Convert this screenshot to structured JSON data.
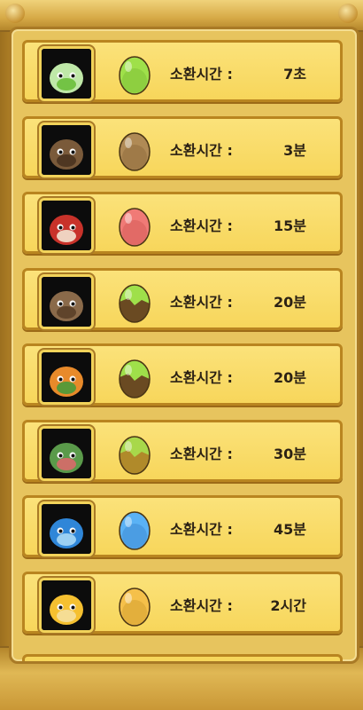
{
  "colors": {
    "row_bg": "#f7d65b",
    "row_border": "#b98520",
    "frame": "#c9982f"
  },
  "rows": [
    {
      "label": "소환시간 :",
      "time": "7초",
      "egg_icon": "green-egg-icon",
      "egg_color": "#7cc23a",
      "monster_icon": "green-sprout-blob-icon"
    },
    {
      "label": "소환시간 :",
      "time": "3분",
      "egg_icon": "brown-egg-icon",
      "egg_color": "#8a6a3a",
      "monster_icon": "brown-rabbit-monster-icon"
    },
    {
      "label": "소환시간 :",
      "time": "15분",
      "egg_icon": "red-egg-icon",
      "egg_color": "#e05a56",
      "monster_icon": "red-panda-monster-icon"
    },
    {
      "label": "소환시간 :",
      "time": "20분",
      "egg_icon": "green-brown-egg-icon",
      "egg_color": "#7cc23a",
      "monster_icon": "brown-mole-monster-icon"
    },
    {
      "label": "소환시간 :",
      "time": "20분",
      "egg_icon": "green-brown-egg-icon",
      "egg_color": "#7cc23a",
      "monster_icon": "orange-bird-monster-icon"
    },
    {
      "label": "소환시간 :",
      "time": "30분",
      "egg_icon": "green-yellow-egg-icon",
      "egg_color": "#9acb3a",
      "monster_icon": "green-turtle-monster-icon"
    },
    {
      "label": "소환시간 :",
      "time": "45분",
      "egg_icon": "blue-egg-icon",
      "egg_color": "#3a8fe0",
      "monster_icon": "blue-seal-monster-icon"
    },
    {
      "label": "소환시간 :",
      "time": "2시간",
      "egg_icon": "gold-egg-icon",
      "egg_color": "#e0a52a",
      "monster_icon": "yellow-chick-monster-icon"
    }
  ]
}
